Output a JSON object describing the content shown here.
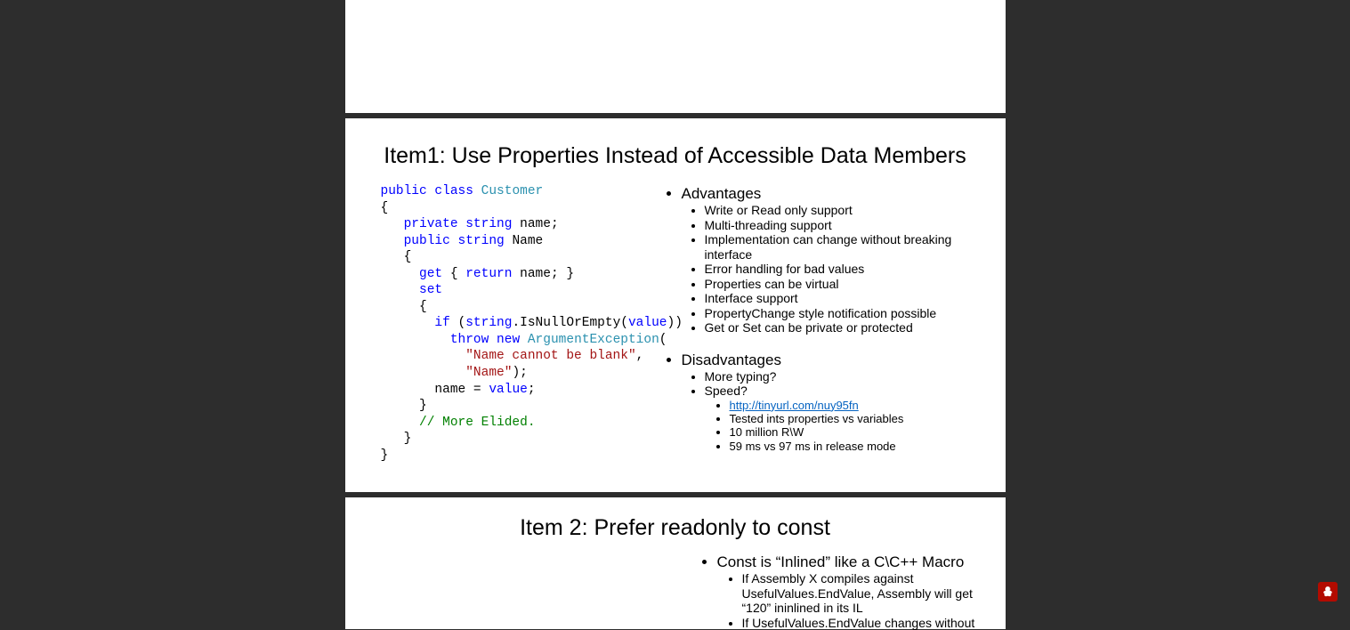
{
  "slide1": {
    "title": "Item1: Use Properties Instead of Accessible Data Members",
    "code": {
      "l1a": "public",
      "l1b": "class",
      "l1c": "Customer",
      "l2": "{",
      "l3a": "private",
      "l3b": "string",
      "l3c": "name;",
      "l4a": "public",
      "l4b": "string",
      "l4c": "Name",
      "l5": "{",
      "l6a": "get",
      "l6b": "{",
      "l6c": "return",
      "l6d": "name; }",
      "l7": "set",
      "l8": "{",
      "l9a": "if",
      "l9b": "(",
      "l9c": "string",
      "l9d": ".IsNullOrEmpty(",
      "l9e": "value",
      "l9f": "))",
      "l10a": "throw",
      "l10b": "new",
      "l10c": "ArgumentException",
      "l10d": "(",
      "l11": "\"Name cannot be blank\"",
      "l11b": ",",
      "l12": "\"Name\"",
      "l12b": ");",
      "l13a": "name = ",
      "l13b": "value",
      "l13c": ";",
      "l14": "}",
      "l15": "// More Elided.",
      "l16": "}",
      "l17": "}"
    },
    "adv_title": "Advantages",
    "adv": [
      "Write or Read only support",
      "Multi-threading support",
      "Implementation can change without breaking interface",
      "Error handling for bad values",
      "Properties can be virtual",
      "Interface support",
      "PropertyChange style notification possible",
      "Get or Set can be private or protected"
    ],
    "dis_title": "Disadvantages",
    "dis": [
      "More typing?",
      "Speed?"
    ],
    "speed_link": "http://tinyurl.com/nuy95fn",
    "speed_sub": [
      "Tested ints properties vs variables",
      "10 million R\\W",
      "59 ms vs 97 ms in release mode"
    ]
  },
  "slide2": {
    "title": "Item 2: Prefer readonly to const",
    "p1": "Const is “Inlined” like a C\\C++ Macro",
    "p1_sub": [
      "If Assembly X compiles against UsefulValues.EndValue, Assembly will get “120” ininlined in its IL",
      "If UsefulValues.EndValue changes without"
    ]
  }
}
